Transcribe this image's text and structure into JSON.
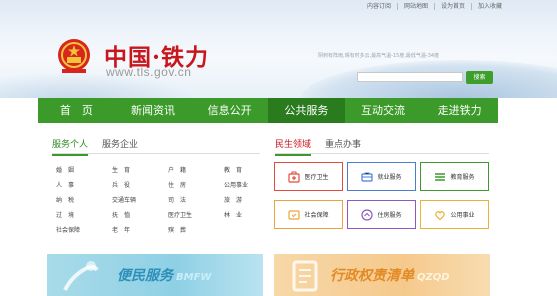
{
  "header": {
    "toplinks": [
      "内容订阅",
      "网站地图",
      "设为首页",
      "加入收藏"
    ],
    "title": "中国·铁力",
    "url": "www.tls.gov.cn",
    "weather": "阴到有阵雨,晴有时多云,最高气温-15度,最低气温-34度",
    "search_placeholder": "",
    "search_button": "搜索"
  },
  "nav": {
    "tabs": [
      "首　页",
      "新闻资讯",
      "信息公开",
      "公共服务",
      "互动交流",
      "走进铁力"
    ],
    "active_index": 3
  },
  "left_panel": {
    "tabs": [
      "服务个人",
      "服务企业"
    ],
    "items": [
      "婚　姻",
      "生　育",
      "户　籍",
      "教　育",
      "人　事",
      "兵　役",
      "住　房",
      "公用事业",
      "纳　税",
      "交通车辆",
      "司　法",
      "旅　游",
      "过　境",
      "抚　恤",
      "医疗卫生",
      "林　业",
      "社会保障",
      "老　年",
      "殡　葬",
      ""
    ]
  },
  "right_panel": {
    "tabs": [
      "民生领域",
      "重点办事"
    ],
    "cards": [
      {
        "label": "医疗卫生",
        "icon": "medical-kit-icon",
        "color": "red"
      },
      {
        "label": "就业服务",
        "icon": "briefcase-icon",
        "color": "blue"
      },
      {
        "label": "教育服务",
        "icon": "book-icon",
        "color": "green"
      },
      {
        "label": "社会保障",
        "icon": "shield-icon",
        "color": "orange"
      },
      {
        "label": "住房服务",
        "icon": "house-icon",
        "color": "purple"
      },
      {
        "label": "公用事业",
        "icon": "heart-icon",
        "color": "yellow"
      }
    ]
  },
  "promos": {
    "left_title": "便民服务",
    "left_sub": "BMFW",
    "right_title": "行政权责清单",
    "right_sub": "QZQD"
  },
  "colors": {
    "nav_green": "#3c9a2a",
    "nav_active": "#2a7a1e",
    "title_red": "#c8161d"
  }
}
